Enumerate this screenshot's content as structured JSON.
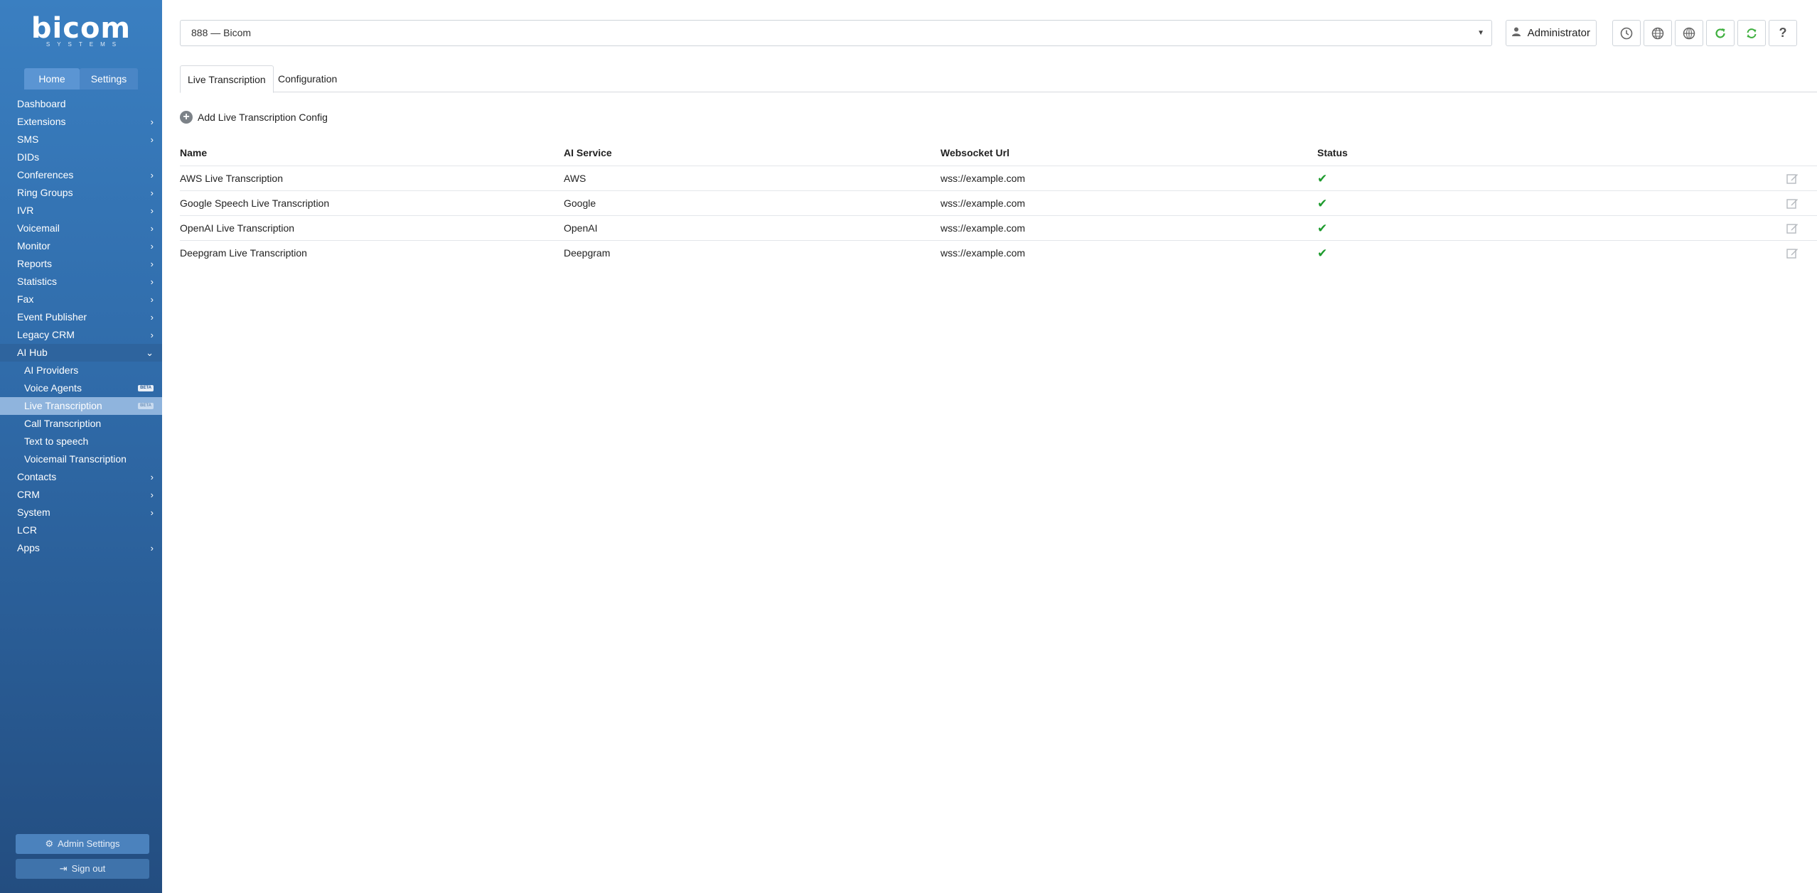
{
  "brand": {
    "logo_text": "bicom",
    "logo_subtext": "SYSTEMS"
  },
  "sidebar": {
    "tabs": [
      {
        "label": "Home"
      },
      {
        "label": "Settings"
      }
    ],
    "items": [
      {
        "label": "Dashboard"
      },
      {
        "label": "Extensions"
      },
      {
        "label": "SMS"
      },
      {
        "label": "DIDs"
      },
      {
        "label": "Conferences"
      },
      {
        "label": "Ring Groups"
      },
      {
        "label": "IVR"
      },
      {
        "label": "Voicemail"
      },
      {
        "label": "Monitor"
      },
      {
        "label": "Reports"
      },
      {
        "label": "Statistics"
      },
      {
        "label": "Fax"
      },
      {
        "label": "Event Publisher"
      },
      {
        "label": "Legacy CRM"
      },
      {
        "label": "AI Hub"
      },
      {
        "label": "AI Providers"
      },
      {
        "label": "Voice Agents",
        "badge": "BETA"
      },
      {
        "label": "Live Transcription",
        "badge": "BETA"
      },
      {
        "label": "Call Transcription"
      },
      {
        "label": "Text to speech"
      },
      {
        "label": "Voicemail Transcription"
      },
      {
        "label": "Contacts"
      },
      {
        "label": "CRM"
      },
      {
        "label": "System"
      },
      {
        "label": "LCR"
      },
      {
        "label": "Apps"
      }
    ],
    "admin_settings_label": "Admin Settings",
    "sign_out_label": "Sign out"
  },
  "header": {
    "tenant_value": "888  —  Bicom",
    "user_label": "Administrator"
  },
  "tabs": [
    {
      "label": "Live Transcription"
    },
    {
      "label": "Configuration"
    }
  ],
  "actions": {
    "add_label": "Add Live Transcription Config"
  },
  "table": {
    "columns": [
      "Name",
      "AI Service",
      "Websocket Url",
      "Status"
    ],
    "rows": [
      {
        "name": "AWS Live Transcription",
        "service": "AWS",
        "url": "wss://example.com"
      },
      {
        "name": "Google Speech Live Transcription",
        "service": "Google",
        "url": "wss://example.com"
      },
      {
        "name": "OpenAI Live Transcription",
        "service": "OpenAI",
        "url": "wss://example.com"
      },
      {
        "name": "Deepgram Live Transcription",
        "service": "Deepgram",
        "url": "wss://example.com"
      }
    ]
  },
  "colors": {
    "sidebar_top": "#3a7fc1",
    "sidebar_bottom": "#234d80",
    "status_ok": "#1e9b2e",
    "refresh_green": "#3eaf3e"
  }
}
